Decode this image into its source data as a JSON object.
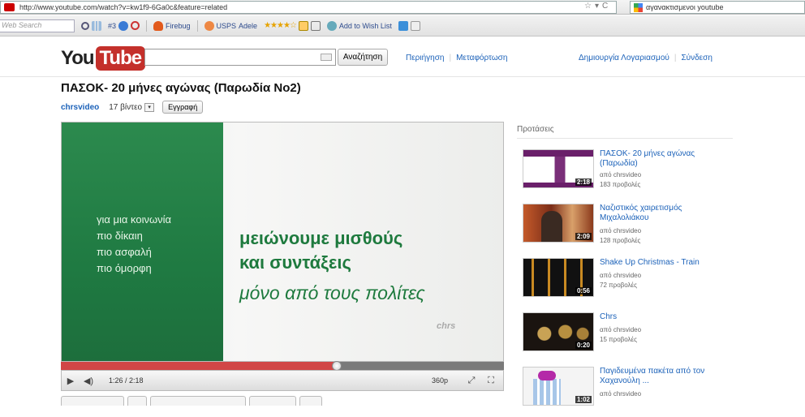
{
  "browser": {
    "url": "http://www.youtube.com/watch?v=kw1f9-6Ga0c&feature=related",
    "search_query": "αγανακτισμενοι youtube",
    "toolbar": {
      "web_search_placeholder": "Web Search",
      "count_label": "#3",
      "firebug": "Firebug",
      "usps": "USPS",
      "adele": "Adele",
      "stars": "★★★★☆",
      "wishlist": "Add to Wish List"
    }
  },
  "youtube": {
    "logo_you": "You",
    "logo_tube": "Tube",
    "search_button": "Αναζήτηση",
    "nav": {
      "browse": "Περιήγηση",
      "upload": "Μεταφόρτωση",
      "create_account": "Δημιουργία Λογαριασμού",
      "sign_in": "Σύνδεση"
    }
  },
  "video": {
    "title": "ΠΑΣΟΚ- 20 μήνες αγώνας (Παρωδία Νο2)",
    "uploader": "chrsvideo",
    "video_count": "17 βίντεο",
    "subscribe": "Εγγραφή",
    "frame": {
      "left_lines": [
        "για μια κοινωνία",
        "πιο δίκαιη",
        "πιο ασφαλή",
        "πιο όμορφη"
      ],
      "main_line1": "μειώνουμε μισθούς",
      "main_line2": "και συντάξεις",
      "main_line3": "μόνο από τους πολίτες",
      "watermark": "chrs"
    },
    "time": "1:26 / 2:18",
    "progress": 0.623,
    "quality": "360p"
  },
  "sidebar": {
    "title": "Προτάσεις",
    "items": [
      {
        "title": "ΠΑΣΟΚ- 20 μήνες αγώνας (Παρωδία)",
        "by": "από chrsvideo",
        "views": "183 προβολές",
        "duration": "2:18"
      },
      {
        "title": "Ναζιστικός χαιρετισμός Μιχαλολιάκου",
        "by": "από chrsvideo",
        "views": "128 προβολές",
        "duration": "2:09"
      },
      {
        "title": "Shake Up Christmas - Train",
        "by": "από chrsvideo",
        "views": "72 προβολές",
        "duration": "0:56"
      },
      {
        "title": "Chrs",
        "by": "από chrsvideo",
        "views": "15 προβολές",
        "duration": "0:20"
      },
      {
        "title": "Παγιδευμένα πακέτα από τον Χαχανούλη ...",
        "by": "από chrsvideo",
        "views": "",
        "duration": "1:02"
      }
    ]
  }
}
